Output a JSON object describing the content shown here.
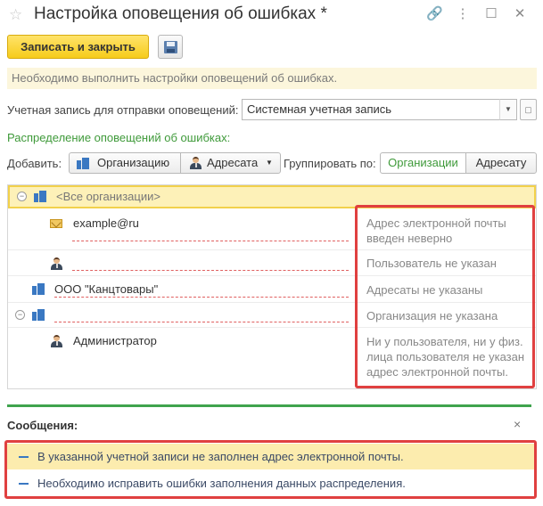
{
  "window": {
    "title": "Настройка оповещения об ошибках *",
    "buttons": [
      "🔗",
      "⋮",
      "☐",
      "✕"
    ]
  },
  "toolbar": {
    "save_close_label": "Записать и закрыть"
  },
  "info_message": "Необходимо выполнить настройки оповещений об ошибках.",
  "account": {
    "label": "Учетная запись для отправки оповещений:",
    "value": "Системная учетная запись"
  },
  "distribution_label": "Распределение оповещений об ошибках:",
  "add": {
    "label": "Добавить:",
    "organization_button": "Организацию",
    "recipient_button": "Адресата"
  },
  "group": {
    "label": "Группировать по:",
    "by_org": "Организации",
    "by_recipient": "Адресату"
  },
  "grid": {
    "rows": [
      {
        "text": "<Все организации>",
        "error": ""
      },
      {
        "text": "example@ru",
        "error": "Адрес электронной почты введен неверно"
      },
      {
        "text": "",
        "error": "Пользователь не указан"
      },
      {
        "text": "ООО \"Канцтовары\"",
        "error": "Адресаты не указаны"
      },
      {
        "text": "",
        "error": "Организация не указана"
      },
      {
        "text": "Администратор",
        "error": "Ни у пользователя, ни у физ. лица пользователя не указан адрес электронной почты."
      }
    ]
  },
  "messages": {
    "title": "Сообщения:",
    "close": "×",
    "items": [
      "В указанной учетной записи не заполнен адрес электронной почты.",
      "Необходимо исправить ошибки заполнения данных распределения."
    ]
  },
  "colors": {
    "accent_yellow": "#f6cc1b",
    "error_red": "#e04040",
    "green": "#3fa34d",
    "info_bg": "#fcf6dc",
    "highlight_row": "#fdf1b8"
  }
}
